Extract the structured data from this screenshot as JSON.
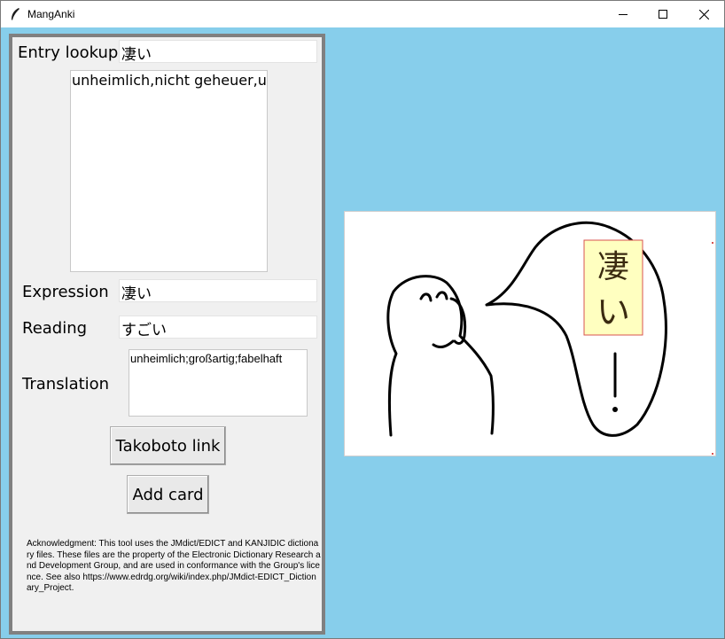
{
  "window": {
    "title": "MangAnki",
    "controls": {
      "minimize_icon": "minimize-icon",
      "maximize_icon": "maximize-icon",
      "close_icon": "close-icon"
    }
  },
  "form": {
    "entry_lookup": {
      "label": "Entry lookup",
      "value": "凄い"
    },
    "lookup_results": [
      "unheimlich,nicht geheuer,u"
    ],
    "expression": {
      "label": "Expression",
      "value": "凄い"
    },
    "reading": {
      "label": "Reading",
      "value": "すごい"
    },
    "translation": {
      "label": "Translation",
      "value": "unheimlich;großartig;fabelhaft"
    },
    "takoboto_button": "Takoboto link",
    "add_card_button": "Add card",
    "acknowledgment": "Acknowledgment: This tool uses the JMdict/EDICT and KANJIDIC dictionary files. These files are the property of the Electronic Dictionary Research and Development Group, and are used in conformance with the Group's licence. See also https://www.edrdg.org/wiki/index.php/JMdict-EDICT_Dictionary_Project."
  },
  "image_panel": {
    "selection_text_1": "凄",
    "selection_text_2": "い"
  },
  "colors": {
    "background": "#87ceeb",
    "panel": "#f0f0f0",
    "panel_border": "#808080",
    "selection_fill": "#ffffc0",
    "selection_border": "#d9534f"
  }
}
